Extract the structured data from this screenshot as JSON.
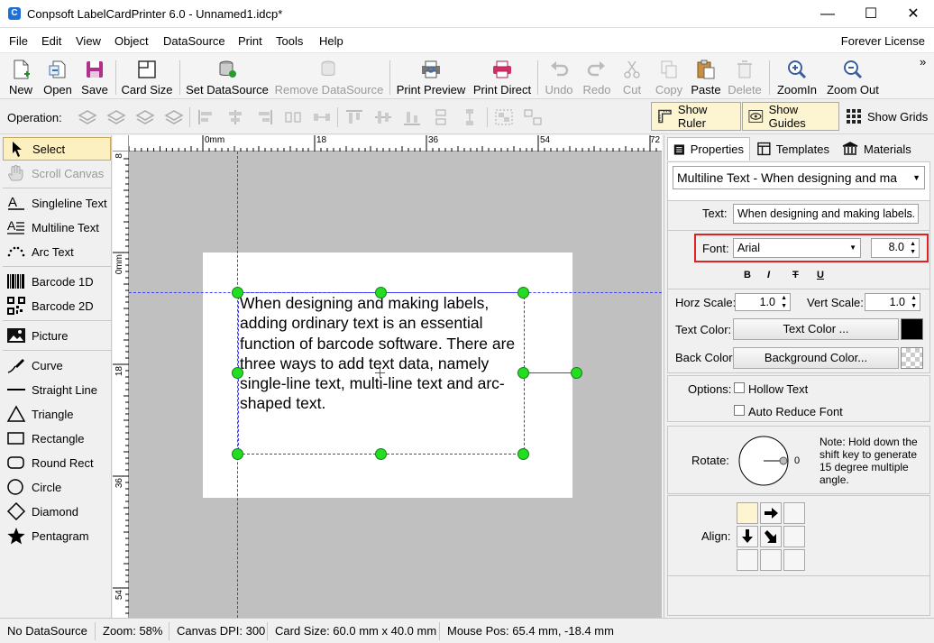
{
  "window": {
    "title": "Conpsoft LabelCardPrinter 6.0 - Unnamed1.idcp*",
    "app_icon_glyph": "C"
  },
  "menu": {
    "items": [
      "File",
      "Edit",
      "View",
      "Object",
      "DataSource",
      "Print",
      "Tools",
      "Help"
    ],
    "license": "Forever License"
  },
  "toolbar": {
    "new": "New",
    "open": "Open",
    "save": "Save",
    "card_size": "Card Size",
    "set_datasource": "Set DataSource",
    "remove_datasource": "Remove DataSource",
    "print_preview": "Print Preview",
    "print_direct": "Print Direct",
    "undo": "Undo",
    "redo": "Redo",
    "cut": "Cut",
    "copy": "Copy",
    "paste": "Paste",
    "delete": "Delete",
    "zoomin": "ZoomIn",
    "zoomout": "Zoom Out",
    "more": "»"
  },
  "opbar": {
    "label": "Operation:",
    "show_ruler": "Show Ruler",
    "show_guides": "Show Guides",
    "show_grids": "Show Grids"
  },
  "tools": {
    "select": "Select",
    "scroll": "Scroll Canvas",
    "singleline": "Singleline Text",
    "multiline": "Multiline Text",
    "arc": "Arc Text",
    "barcode1d": "Barcode 1D",
    "barcode2d": "Barcode 2D",
    "picture": "Picture",
    "curve": "Curve",
    "line": "Straight Line",
    "triangle": "Triangle",
    "rectangle": "Rectangle",
    "roundrect": "Round Rect",
    "circle": "Circle",
    "diamond": "Diamond",
    "pentagram": "Pentagram"
  },
  "ruler": {
    "h": [
      "0mm",
      "18",
      "36",
      "54",
      "72"
    ],
    "v": [
      "8",
      "0mm",
      "18",
      "36",
      "54"
    ]
  },
  "canvas": {
    "text": "When designing and making labels, adding ordinary text is an essential function of barcode software. There are three ways to add text data, namely single-line text, multi-line text and arc-shaped text."
  },
  "panel": {
    "tabs": [
      "Properties",
      "Templates",
      "Materials"
    ],
    "object_select": "Multiline Text - When designing and ma",
    "text_label": "Text:",
    "text_value": "When designing and making labels",
    "text_more": "...",
    "font_label": "Font:",
    "font_name": "Arial",
    "font_size": "8.0",
    "style_bold": "B",
    "style_italic": "I",
    "style_strike": "T",
    "style_underline": "U",
    "horz_label": "Horz Scale:",
    "horz_value": "1.0",
    "vert_label": "Vert Scale:",
    "vert_value": "1.0",
    "text_color_label": "Text Color:",
    "text_color_btn": "Text Color ...",
    "text_color": "#000000",
    "back_color_label": "Back Color:",
    "back_color_btn": "Background Color...",
    "options_label": "Options:",
    "hollow": "Hollow Text",
    "auto_reduce": "Auto Reduce Font",
    "rotate_label": "Rotate:",
    "rotate_value": "0",
    "rotate_note": "Note: Hold down the shift key to generate 15 degree multiple angle.",
    "align_label": "Align:"
  },
  "status": {
    "datasource": "No DataSource",
    "zoom": "Zoom: 58%",
    "dpi": "Canvas DPI: 300",
    "card": "Card Size: 60.0 mm x 40.0 mm",
    "mouse": "Mouse Pos: 65.4 mm, -18.4 mm"
  },
  "colors": {
    "accent": "#1e6fd9",
    "handle": "#22dd22",
    "guide": "#4040ff",
    "selected_tool_bg": "#fdf0c0",
    "highlight_border": "#dd2222"
  }
}
